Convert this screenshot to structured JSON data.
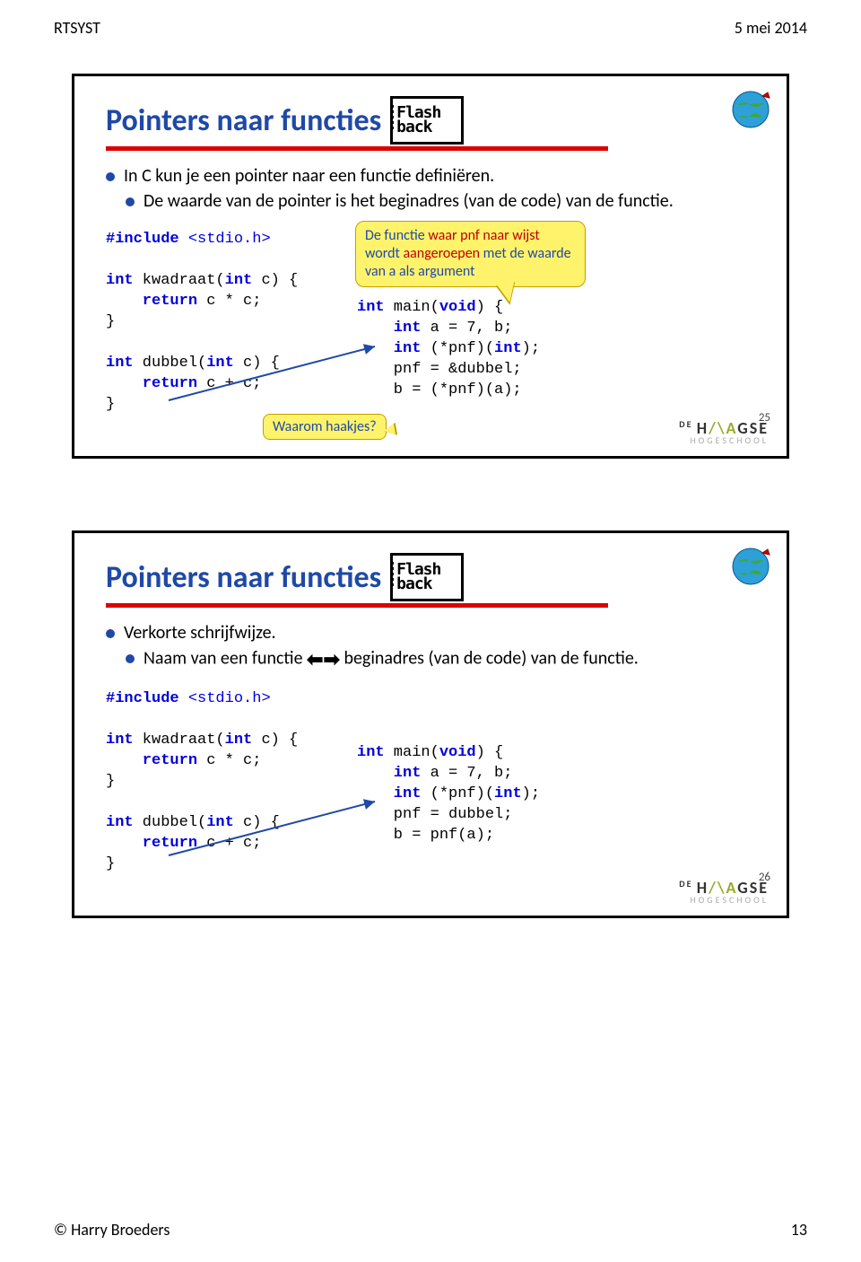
{
  "header": {
    "left": "RTSYST",
    "right": "5 mei 2014"
  },
  "footer": {
    "left": "© Harry Broeders",
    "right": "13"
  },
  "slide1": {
    "title": "Pointers naar functies",
    "bullet1": "In C kun je een pointer naar een functie definiëren.",
    "bullet2": "De waarde van de pointer is het beginadres (van de code) van de functie.",
    "callout1_a": "De functie ",
    "callout1_b": "waar pnf naar wijst",
    "callout1_c": " wordt ",
    "callout1_d": "aangeroepen",
    "callout1_e": " met de waarde van a als argument",
    "callout2": "Waarom haakjes?",
    "code_left": {
      "l1a": "#include",
      "l1b": " <stdio.h>",
      "l3a": "int",
      "l3b": " kwadraat(",
      "l3c": "int",
      "l3d": " c) {",
      "l4a": "    return",
      "l4b": " c * c;",
      "l5": "}",
      "l6a": "int",
      "l6b": " dubbel(",
      "l6c": "int",
      "l6d": " c) {",
      "l7a": "    return",
      "l7b": " c + c;",
      "l8": "}"
    },
    "code_right": {
      "r1a": "int",
      "r1b": " main(",
      "r1c": "void",
      "r1d": ") {",
      "r2a": "    int",
      "r2b": " a = 7, b;",
      "r3a": "    int",
      "r3b": " (*pnf)(",
      "r3c": "int",
      "r3d": ");",
      "r4": "    pnf = &dubbel;",
      "r5": "    b = (*pnf)(a);"
    },
    "num": "25"
  },
  "slide2": {
    "title": "Pointers naar functies",
    "bullet1": "Verkorte schrijfwijze.",
    "bullet2a": "Naam van een functie ",
    "bullet2b": " beginadres (van de code) van de functie.",
    "code_left": {
      "l1a": "#include",
      "l1b": " <stdio.h>",
      "l3a": "int",
      "l3b": " kwadraat(",
      "l3c": "int",
      "l3d": " c) {",
      "l4a": "    return",
      "l4b": " c * c;",
      "l5": "}",
      "l6a": "int",
      "l6b": " dubbel(",
      "l6c": "int",
      "l6d": " c) {",
      "l7a": "    return",
      "l7b": " c + c;",
      "l8": "}"
    },
    "code_right": {
      "r1a": "int",
      "r1b": " main(",
      "r1c": "void",
      "r1d": ") {",
      "r2a": "    int",
      "r2b": " a = 7, b;",
      "r3a": "    int",
      "r3b": " (*pnf)(",
      "r3c": "int",
      "r3d": ");",
      "r4": "    pnf = dubbel;",
      "r5": "    b = pnf(a);"
    },
    "num": "26"
  },
  "logo": {
    "line1_de": "DE ",
    "line1_h": "H",
    "line1_aa": "/\\A",
    "line1_rest": "GSE",
    "line2": "HOGESCHOOL"
  }
}
